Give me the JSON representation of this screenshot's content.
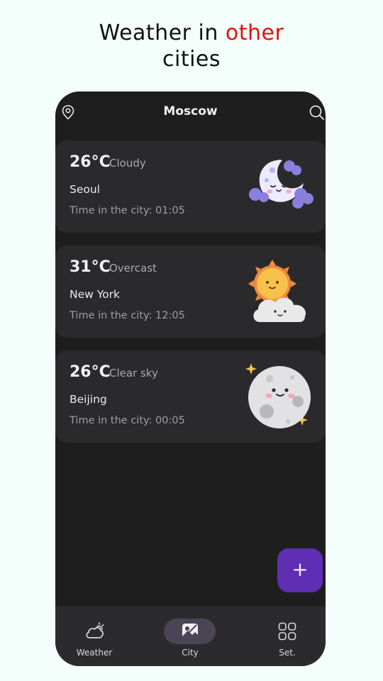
{
  "headline": {
    "part1": "Weather in ",
    "accent": "other",
    "part2": "cities"
  },
  "colors": {
    "accent_text": "#e0120f",
    "fab": "#5f2eb3",
    "card": "#2a2a2c",
    "screen": "#1e1e1f"
  },
  "topbar": {
    "title": "Moscow",
    "left_icon": "location-pin-icon",
    "right_icon": "search-icon"
  },
  "cities": [
    {
      "temp": "26°C",
      "condition": "Cloudy",
      "name": "Seoul",
      "time_label": "Time in the city:",
      "time": "01:05",
      "icon": "moon-with-clouds-icon"
    },
    {
      "temp": "31°C",
      "condition": "Overcast",
      "name": "New York",
      "time_label": "Time in the city:",
      "time": "12:05",
      "icon": "sun-behind-cloud-icon"
    },
    {
      "temp": "26°C",
      "condition": "Clear sky",
      "name": "Beijing",
      "time_label": "Time in the city:",
      "time": "00:05",
      "icon": "full-moon-icon"
    }
  ],
  "fab": {
    "label": "+"
  },
  "nav": {
    "items": [
      {
        "label": "Weather",
        "icon": "cloud-sun-icon"
      },
      {
        "label": "City",
        "icon": "city-image-icon",
        "active": true
      },
      {
        "label": "Set.",
        "icon": "grid-icon"
      }
    ]
  }
}
